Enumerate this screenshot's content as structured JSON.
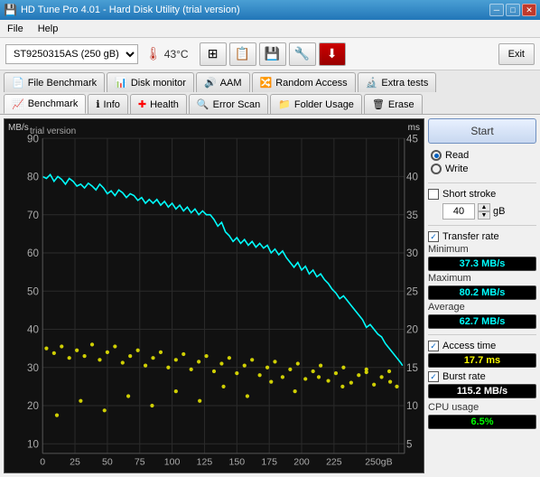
{
  "window": {
    "title": "HD Tune Pro 4.01 - Hard Disk Utility (trial version)",
    "title_icon": "💾"
  },
  "menu": {
    "items": [
      "File",
      "Help"
    ]
  },
  "toolbar": {
    "drive": "ST9250315AS        (250 gB)",
    "temp": "43°C",
    "exit_label": "Exit"
  },
  "tabs_row1": [
    {
      "label": "File Benchmark",
      "icon": "📄",
      "active": false
    },
    {
      "label": "Disk monitor",
      "icon": "📊",
      "active": false
    },
    {
      "label": "AAM",
      "icon": "🔊",
      "active": false
    },
    {
      "label": "Random Access",
      "icon": "🔀",
      "active": false
    },
    {
      "label": "Extra tests",
      "icon": "🔬",
      "active": false
    }
  ],
  "tabs_row2": [
    {
      "label": "Benchmark",
      "icon": "📈",
      "active": true
    },
    {
      "label": "Info",
      "icon": "ℹ",
      "active": false
    },
    {
      "label": "Health",
      "icon": "➕",
      "active": false
    },
    {
      "label": "Error Scan",
      "icon": "🔍",
      "active": false
    },
    {
      "label": "Folder Usage",
      "icon": "📁",
      "active": false
    },
    {
      "label": "Erase",
      "icon": "🗑",
      "active": false
    }
  ],
  "chart": {
    "label_mbs": "MB/s",
    "label_ms": "ms",
    "y_labels_left": [
      "90",
      "80",
      "70",
      "60",
      "50",
      "40",
      "30",
      "20",
      "10"
    ],
    "y_labels_right": [
      "45",
      "40",
      "35",
      "30",
      "25",
      "20",
      "15",
      "10",
      "5"
    ],
    "x_labels": [
      "0",
      "25",
      "50",
      "75",
      "100",
      "125",
      "150",
      "175",
      "200",
      "225",
      "250gB"
    ],
    "watermark": "trial version"
  },
  "right_panel": {
    "start_label": "Start",
    "read_label": "Read",
    "write_label": "Write",
    "short_stroke_label": "Short stroke",
    "short_stroke_value": "40",
    "short_stroke_unit": "gB",
    "transfer_rate_label": "Transfer rate",
    "minimum_label": "Minimum",
    "minimum_value": "37.3 MB/s",
    "maximum_label": "Maximum",
    "maximum_value": "80.2 MB/s",
    "average_label": "Average",
    "average_value": "62.7 MB/s",
    "access_time_label": "Access time",
    "access_time_value": "17.7 ms",
    "burst_rate_label": "Burst rate",
    "burst_rate_value": "115.2 MB/s",
    "cpu_usage_label": "CPU usage",
    "cpu_usage_value": "6.5%"
  }
}
